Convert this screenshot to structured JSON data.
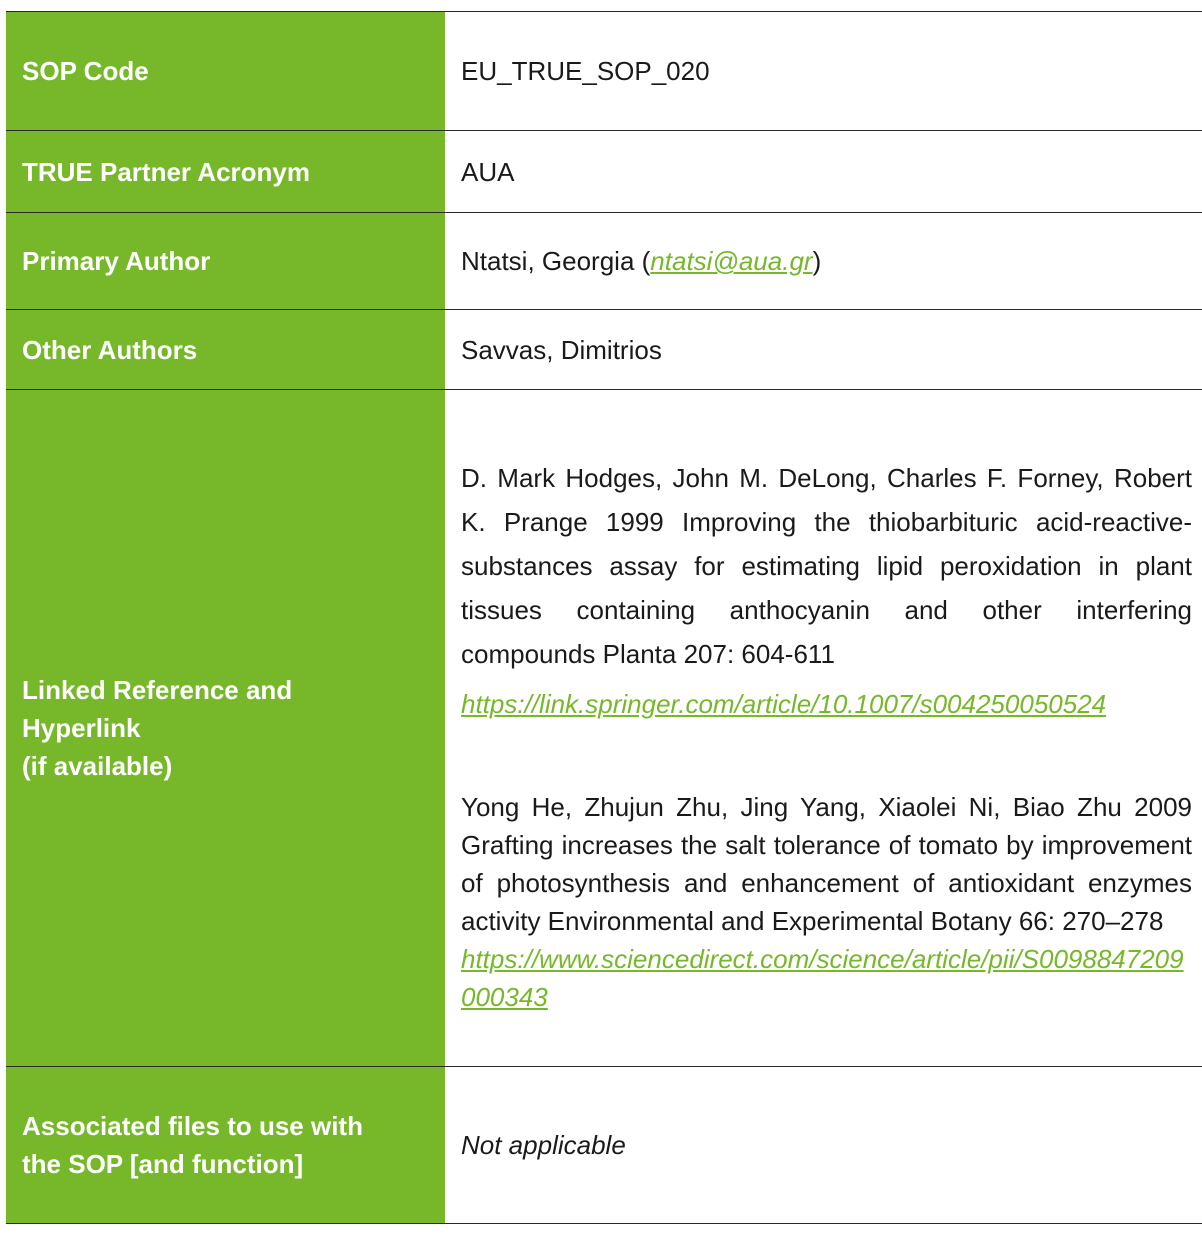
{
  "rows": {
    "sop_code": {
      "label": "SOP Code",
      "value": "EU_TRUE_SOP_020"
    },
    "partner": {
      "label": "TRUE Partner Acronym",
      "value": "AUA"
    },
    "primary_author": {
      "label": "Primary Author",
      "name": "Ntatsi, Georgia (",
      "email": "ntatsi@aua.gr",
      "close": ")"
    },
    "other_authors": {
      "label": "Other Authors",
      "value": "Savvas, Dimitrios"
    },
    "reference": {
      "label_line1": "Linked Reference and",
      "label_line2": "Hyperlink",
      "label_line3": "(if available)",
      "ref1_text": "D. Mark Hodges, John M. DeLong, Charles F. Forney, Robert K. Prange 1999 Improving the thiobarbituric acid-reactive-substances assay for estimating lipid peroxidation in plant tissues containing anthocyanin and other interfering compounds Planta 207: 604-611",
      "ref1_link": "https://link.springer.com/article/10.1007/s004250050524",
      "ref2_text": "Yong He, Zhujun Zhu, Jing Yang, Xiaolei Ni, Biao Zhu 2009 Grafting increases the salt tolerance of tomato by improvement of photosynthesis and enhancement of antioxidant enzymes activity Environmental and Experimental Botany 66: 270–278",
      "ref2_link": "https://www.sciencedirect.com/science/article/pii/S0098847209000343"
    },
    "associated_files": {
      "label_line1": "Associated files to use with",
      "label_line2": "the SOP [and function]",
      "value": "Not applicable"
    }
  },
  "colors": {
    "label_background": "#76b82a",
    "label_text": "#ffffff",
    "link": "#76b82a",
    "border": "#2a2a2a"
  }
}
